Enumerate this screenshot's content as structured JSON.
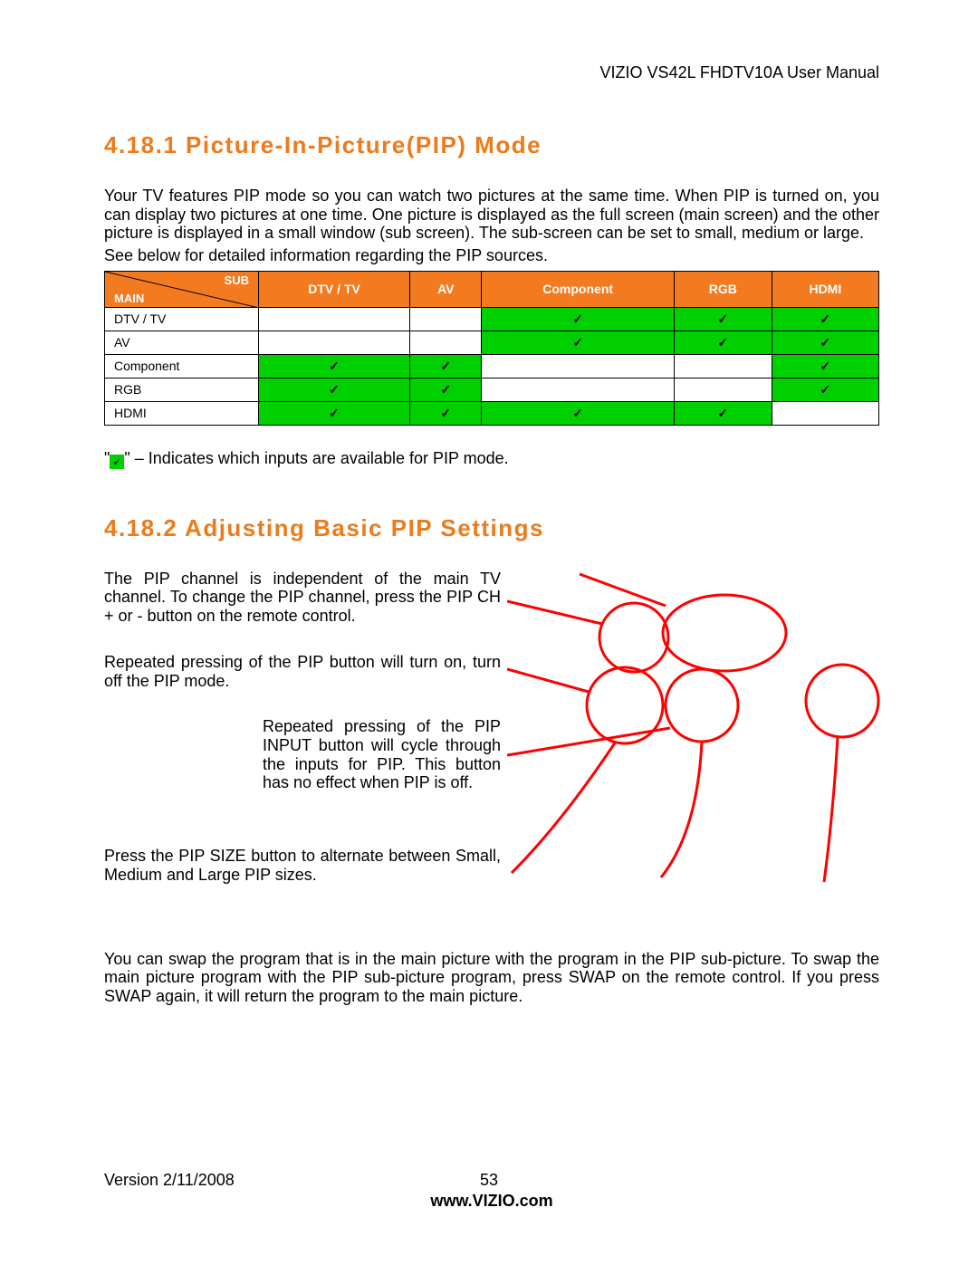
{
  "header": {
    "manual_title": "VIZIO VS42L FHDTV10A User Manual"
  },
  "section1": {
    "heading": "4.18.1 Picture-In-Picture(PIP) Mode",
    "para1": "Your TV features PIP mode so you can watch two pictures at the same time. When PIP is turned on, you can display two pictures at one time. One picture is displayed as the full screen (main screen) and the other picture is displayed in a small window (sub screen). The sub-screen can be set to small, medium or large.",
    "para2": "See below for detailed information regarding the PIP sources."
  },
  "table": {
    "corner_sub": "SUB",
    "corner_main": "MAIN",
    "columns": [
      "DTV / TV",
      "AV",
      "Component",
      "RGB",
      "HDMI"
    ],
    "rows": [
      {
        "label": "DTV / TV",
        "cells": [
          "",
          "",
          "yes",
          "yes",
          "yes"
        ]
      },
      {
        "label": "AV",
        "cells": [
          "",
          "",
          "yes",
          "yes",
          "yes"
        ]
      },
      {
        "label": "Component",
        "cells": [
          "yes",
          "yes",
          "",
          "",
          "yes"
        ]
      },
      {
        "label": "RGB",
        "cells": [
          "yes",
          "yes",
          "",
          "",
          "yes"
        ]
      },
      {
        "label": "HDMI",
        "cells": [
          "yes",
          "yes",
          "yes",
          "yes",
          ""
        ]
      }
    ]
  },
  "legend": {
    "prefix": "\"",
    "check": "✓",
    "suffix": "\" – Indicates which inputs are available for PIP mode."
  },
  "section2": {
    "heading": "4.18.2 Adjusting Basic PIP Settings",
    "para1": "The PIP channel is independent of the main TV channel. To change the PIP channel, press the PIP CH + or - button on the remote control.",
    "para2": "Repeated pressing of the PIP button will turn on, turn off the PIP mode.",
    "para3": "Repeated pressing of the PIP INPUT button will cycle through the inputs for PIP.  This button has no effect when PIP is off.",
    "para4": "Press the PIP SIZE button to alternate between Small, Medium and Large PIP sizes.",
    "para5": "You can swap the program that is in the main picture with the program in the PIP sub-picture.  To swap the main picture program with the PIP sub-picture program, press SWAP on the remote control. If you press SWAP again, it will return the program to the main picture."
  },
  "footer": {
    "version": "Version 2/11/2008",
    "page": "53",
    "site": "www.VIZIO.com"
  },
  "chart_data": {
    "type": "table",
    "title": "PIP source compatibility (✓ = available)",
    "columns": [
      "MAIN \\ SUB",
      "DTV / TV",
      "AV",
      "Component",
      "RGB",
      "HDMI"
    ],
    "rows": [
      [
        "DTV / TV",
        false,
        false,
        true,
        true,
        true
      ],
      [
        "AV",
        false,
        false,
        true,
        true,
        true
      ],
      [
        "Component",
        true,
        true,
        false,
        false,
        true
      ],
      [
        "RGB",
        true,
        true,
        false,
        false,
        true
      ],
      [
        "HDMI",
        true,
        true,
        true,
        true,
        false
      ]
    ]
  }
}
